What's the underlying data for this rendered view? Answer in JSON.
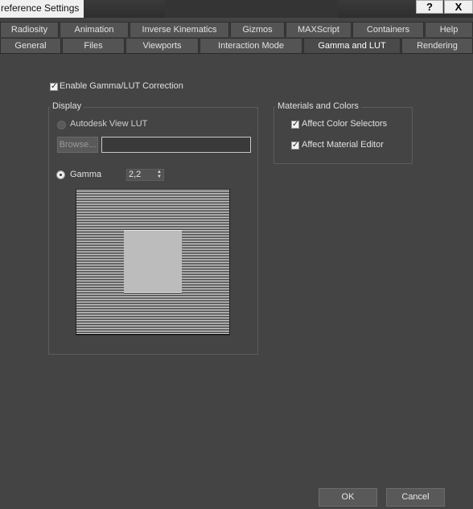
{
  "window": {
    "title": "reference Settings",
    "help_label": "?",
    "close_label": "X"
  },
  "tabs_row1": [
    "Radiosity",
    "Animation",
    "Inverse Kinematics",
    "Gizmos",
    "MAXScript",
    "Containers",
    "Help"
  ],
  "tabs_row2": [
    "General",
    "Files",
    "Viewports",
    "Interaction Mode",
    "Gamma and LUT",
    "Rendering"
  ],
  "active_tab": "Gamma and LUT",
  "enable_gamma": {
    "label": "Enable Gamma/LUT Correction",
    "checked": true
  },
  "display": {
    "title": "Display",
    "lut_option": {
      "label": "Autodesk View LUT",
      "selected": false
    },
    "browse_label": "Browse...",
    "lut_path": "",
    "gamma_option": {
      "label": "Gamma",
      "selected": true
    },
    "gamma_value": "2,2"
  },
  "materials": {
    "title": "Materials and Colors",
    "affect_color_selectors": {
      "label": "Affect Color Selectors",
      "checked": true
    },
    "affect_material_editor": {
      "label": "Affect Material Editor",
      "checked": true
    }
  },
  "footer": {
    "ok_label": "OK",
    "cancel_label": "Cancel"
  },
  "colors": {
    "background": "#444444",
    "tab_active": "#4a4a4a",
    "tab_inactive": "#545454"
  }
}
